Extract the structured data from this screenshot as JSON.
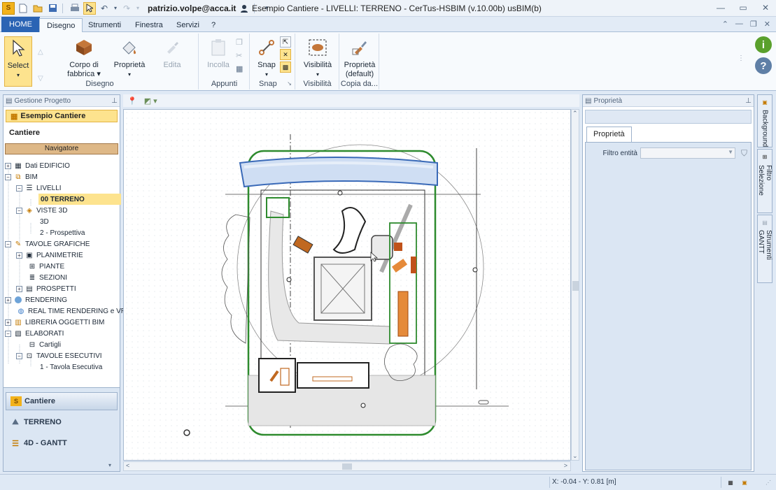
{
  "app": {
    "window_title": "Esempio Cantiere - LIVELLI: TERRENO - CerTus-HSBIM (v.10.00b) usBIM(b)",
    "user": "patrizio.volpe@acca.it"
  },
  "ribbon_tabs": [
    {
      "label": "HOME"
    },
    {
      "label": "Disegno"
    },
    {
      "label": "Strumenti"
    },
    {
      "label": "Finestra"
    },
    {
      "label": "Servizi"
    },
    {
      "label": "?"
    }
  ],
  "ribbon": {
    "select": "Select",
    "corpo_line1": "Corpo di",
    "corpo_line2": "fabbrica",
    "proprieta": "Proprietà",
    "edita": "Edita",
    "incolla": "Incolla",
    "snap": "Snap",
    "visibilita": "Visibilità",
    "proprieta_default_line1": "Proprietà",
    "proprieta_default_line2": "(default)",
    "groups": {
      "disegno": "Disegno",
      "appunti": "Appunti",
      "snap": "Snap",
      "visibilita": "Visibilità",
      "copia": "Copia da..."
    }
  },
  "left_panel": {
    "header": "Gestione Progetto",
    "project": "Esempio Cantiere",
    "section": "Cantiere",
    "navigator": "Navigatore",
    "tree": {
      "dati": "Dati EDIFICIO",
      "bim": "BIM",
      "livelli": "LIVELLI",
      "terreno": "00 TERRENO",
      "viste3d": "VISTE 3D",
      "v3d": "3D",
      "prospettiva": "2 - Prospettiva",
      "tavole": "TAVOLE GRAFICHE",
      "planimetrie": "PLANIMETRIE",
      "piante": "PIANTE",
      "sezioni": "SEZIONI",
      "prospetti": "PROSPETTI",
      "rendering": "RENDERING",
      "rt": "REAL TIME RENDERING e VRi",
      "libreria": "LIBRERIA OGGETTI BIM",
      "elaborati": "ELABORATI",
      "cartigli": "Cartigli",
      "esecutivi": "TAVOLE ESECUTIVI",
      "tavola1": "1 - Tavola Esecutiva"
    },
    "bottom_nav": {
      "cantiere": "Cantiere",
      "terreno": "TERRENO",
      "gantt": "4D - GANTT"
    }
  },
  "right_panel": {
    "header": "Proprietà",
    "tab": "Proprietà",
    "filter_label": "Filtro entità",
    "filter_value": ""
  },
  "side_tabs": {
    "background": "Background",
    "filtro": "Filtro Selezione",
    "gantt": "Strumenti GANTT"
  },
  "status": {
    "coords": "X: -0.04 - Y: 0.81 [m]"
  },
  "colors": {
    "accent": "#2b64b4",
    "highlight": "#fde38e",
    "site_border": "#2e8b2e",
    "road": "#3a6ab8",
    "equipment": "#d2691e"
  }
}
